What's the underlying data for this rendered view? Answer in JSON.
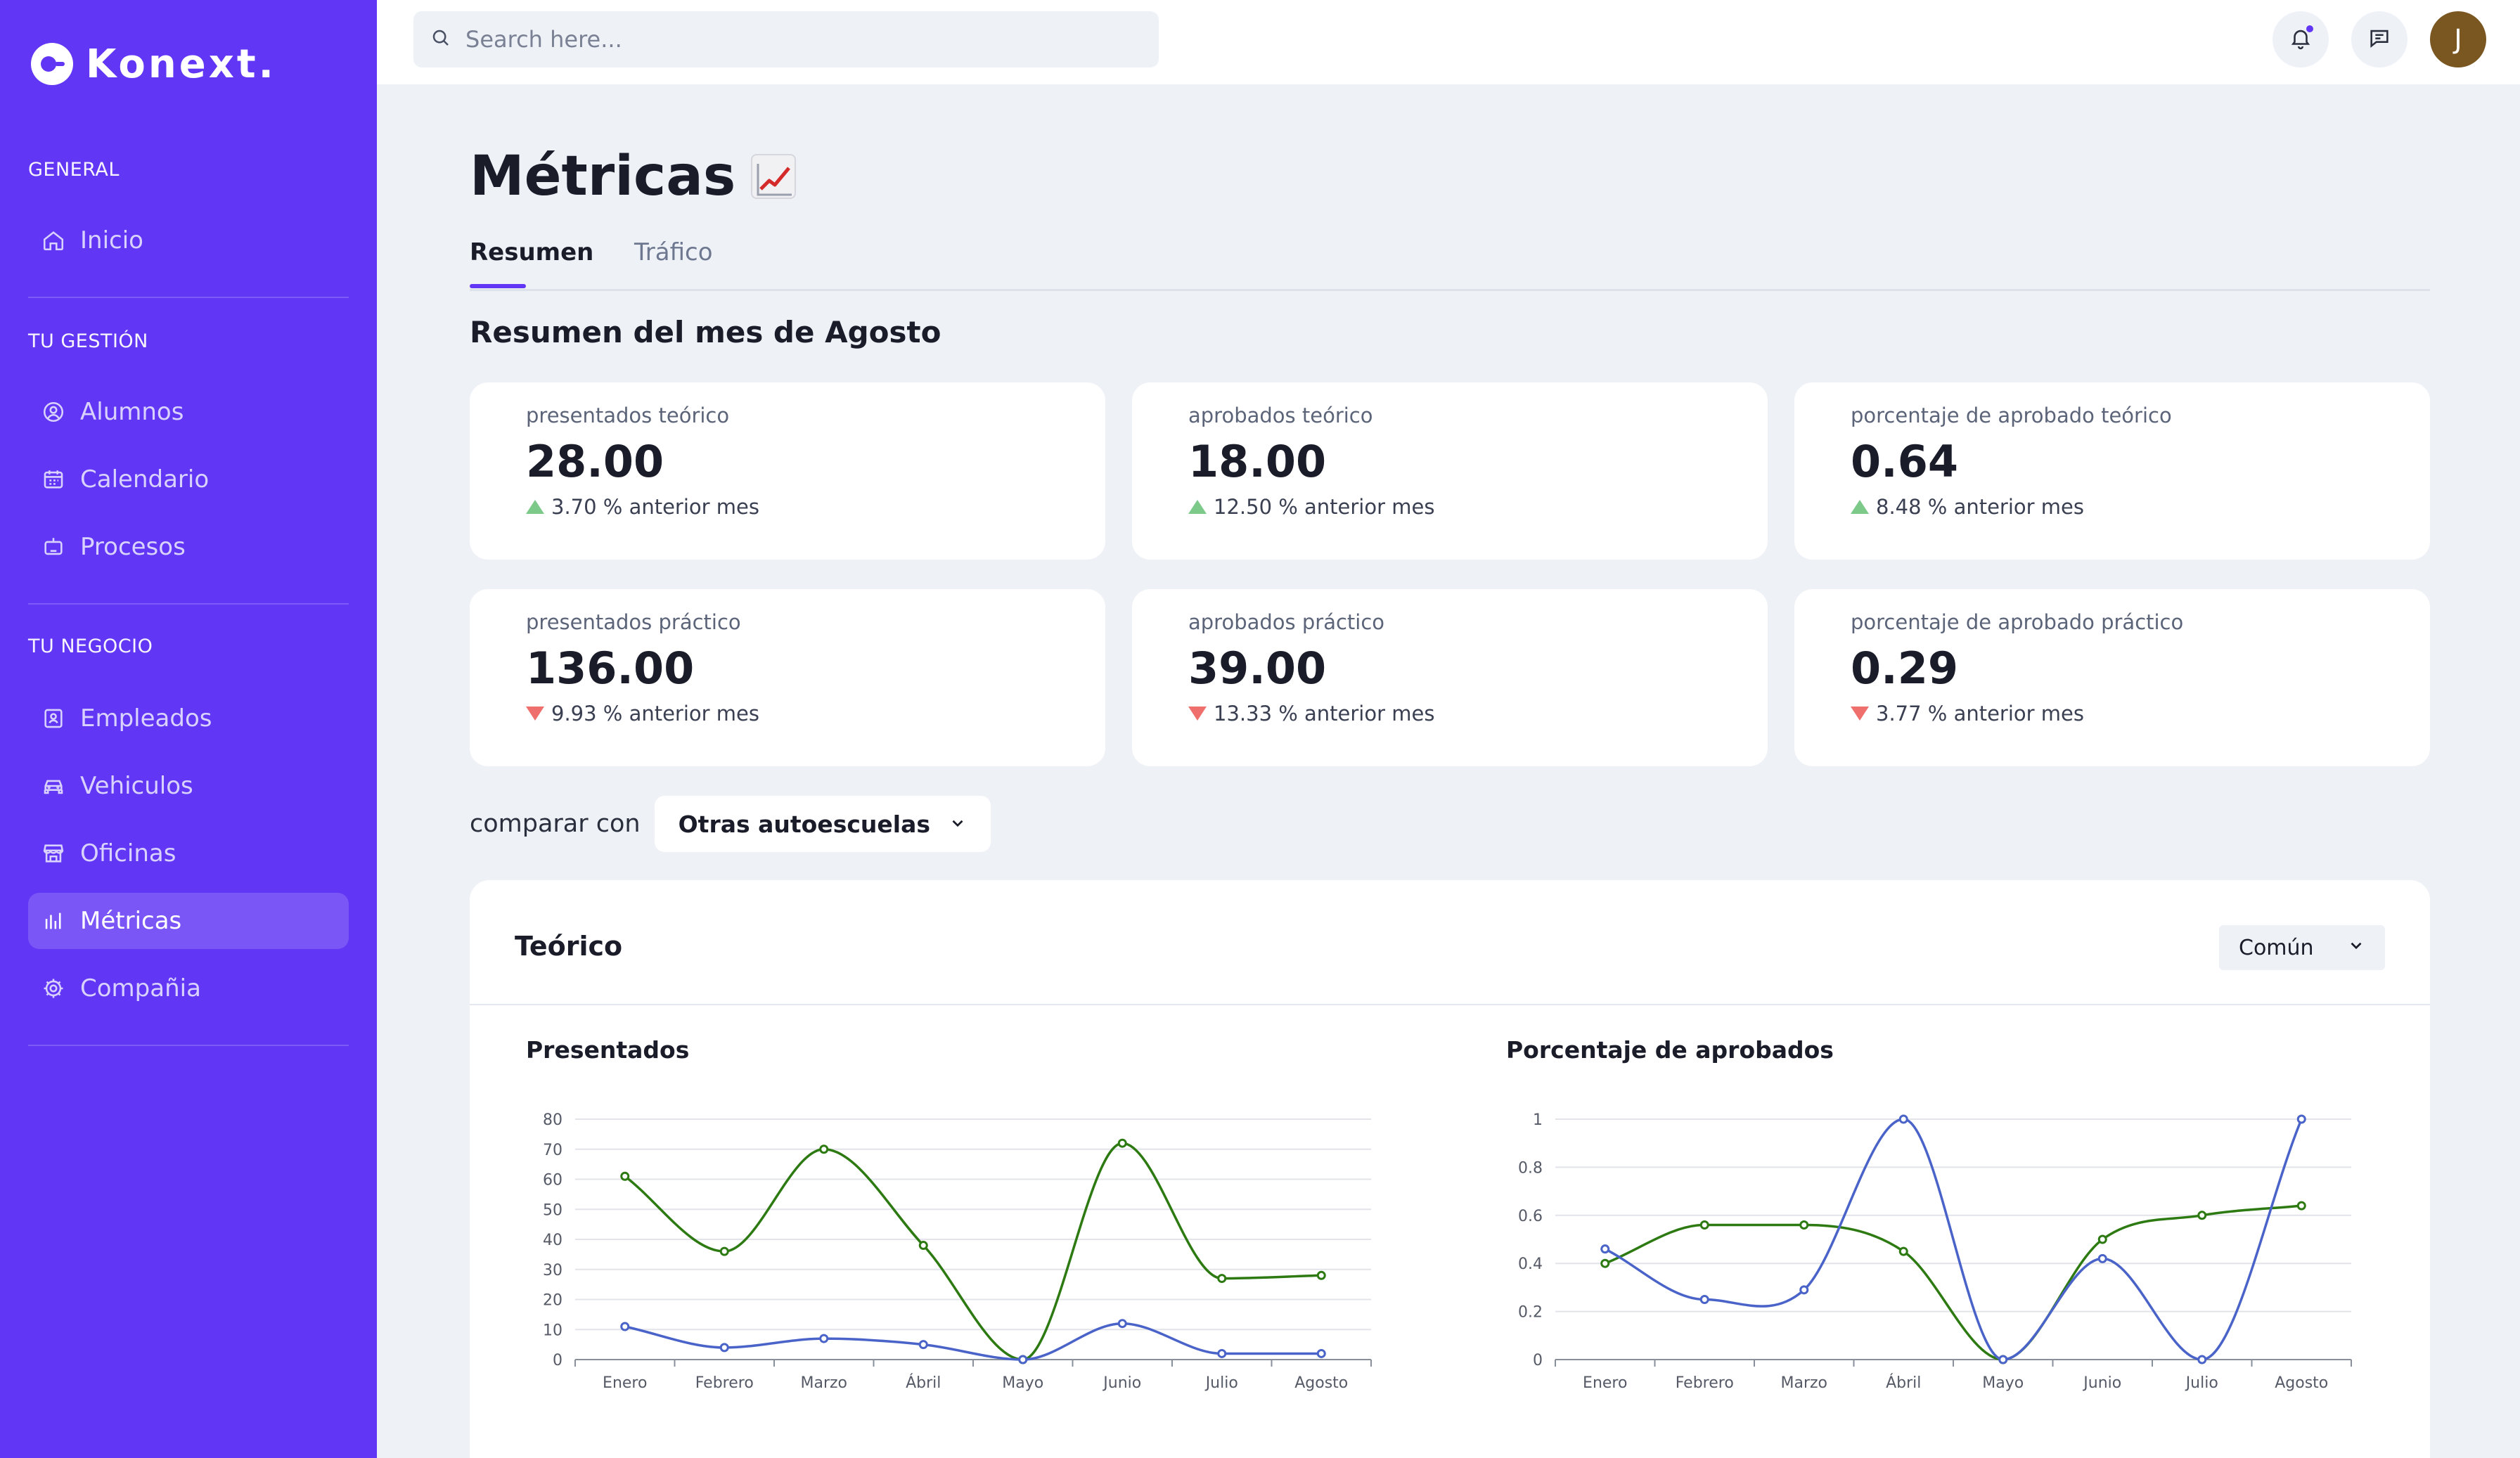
{
  "app": {
    "name": "Konext."
  },
  "sidebar": {
    "sections": [
      {
        "label": "GENERAL"
      },
      {
        "label": "TU GESTIÓN"
      },
      {
        "label": "TU NEGOCIO"
      }
    ],
    "items": [
      {
        "label": "Inicio",
        "icon": "home-icon"
      },
      {
        "label": "Alumnos",
        "icon": "user-circle-icon"
      },
      {
        "label": "Calendario",
        "icon": "calendar-icon"
      },
      {
        "label": "Procesos",
        "icon": "robot-icon"
      },
      {
        "label": "Empleados",
        "icon": "badge-icon"
      },
      {
        "label": "Vehiculos",
        "icon": "car-icon"
      },
      {
        "label": "Oficinas",
        "icon": "store-icon"
      },
      {
        "label": "Métricas",
        "icon": "bar-chart-icon",
        "active": true
      },
      {
        "label": "Compañia",
        "icon": "gear-icon"
      }
    ]
  },
  "topbar": {
    "search_placeholder": "Search here...",
    "avatar_initial": "J",
    "notification_icon": "bell-icon",
    "messages_icon": "chat-icon"
  },
  "page": {
    "title": "Métricas",
    "title_emoji": "chart-increasing-icon",
    "tabs": [
      {
        "label": "Resumen",
        "active": true
      },
      {
        "label": "Tráfico",
        "active": false
      }
    ],
    "summary_title": "Resumen del mes de Agosto"
  },
  "kpis": [
    {
      "label": "presentados teórico",
      "value": "28.00",
      "delta": "3.70 % anterior mes",
      "trend": "up"
    },
    {
      "label": "aprobados teórico",
      "value": "18.00",
      "delta": "12.50 % anterior mes",
      "trend": "up"
    },
    {
      "label": "porcentaje de aprobado teórico",
      "value": "0.64",
      "delta": "8.48 % anterior mes",
      "trend": "up"
    },
    {
      "label": "presentados práctico",
      "value": "136.00",
      "delta": "9.93 % anterior mes",
      "trend": "down"
    },
    {
      "label": "aprobados práctico",
      "value": "39.00",
      "delta": "13.33 % anterior mes",
      "trend": "down"
    },
    {
      "label": "porcentaje de aprobado práctico",
      "value": "0.29",
      "delta": "3.77 % anterior mes",
      "trend": "down"
    }
  ],
  "compare": {
    "label": "comparar con",
    "selected": "Otras autoescuelas"
  },
  "panel": {
    "title": "Teórico",
    "select_value": "Común"
  },
  "colors": {
    "brand": "#6236f5",
    "series_green": "#2d7a12",
    "series_blue": "#4a63c8",
    "trend_up": "#7cc98a",
    "trend_down": "#ef6f6c"
  },
  "chart_data": [
    {
      "type": "line",
      "title": "Presentados",
      "categories": [
        "Enero",
        "Febrero",
        "Marzo",
        "Ábril",
        "Mayo",
        "Junio",
        "Julio",
        "Agosto"
      ],
      "ylim": [
        0,
        80
      ],
      "yticks": [
        "0",
        "10",
        "20",
        "30",
        "40",
        "50",
        "60",
        "70",
        "80"
      ],
      "grid": true,
      "series": [
        {
          "color": "#2d7a12",
          "values": [
            61,
            36,
            70,
            38,
            0,
            72,
            27,
            28
          ]
        },
        {
          "color": "#4a63c8",
          "values": [
            11,
            4,
            7,
            5,
            0,
            12,
            2,
            2
          ]
        }
      ]
    },
    {
      "type": "line",
      "title": "Porcentaje de aprobados",
      "categories": [
        "Enero",
        "Febrero",
        "Marzo",
        "Ábril",
        "Mayo",
        "Junio",
        "Julio",
        "Agosto"
      ],
      "ylim": [
        0,
        1
      ],
      "yticks": [
        "0",
        "0.2",
        "0.4",
        "0.6",
        "0.8",
        "1"
      ],
      "grid": true,
      "series": [
        {
          "color": "#2d7a12",
          "values": [
            0.4,
            0.56,
            0.56,
            0.45,
            0,
            0.5,
            0.6,
            0.64
          ]
        },
        {
          "color": "#4a63c8",
          "values": [
            0.46,
            0.25,
            0.29,
            1.0,
            0,
            0.42,
            0,
            1.0
          ]
        }
      ]
    }
  ]
}
